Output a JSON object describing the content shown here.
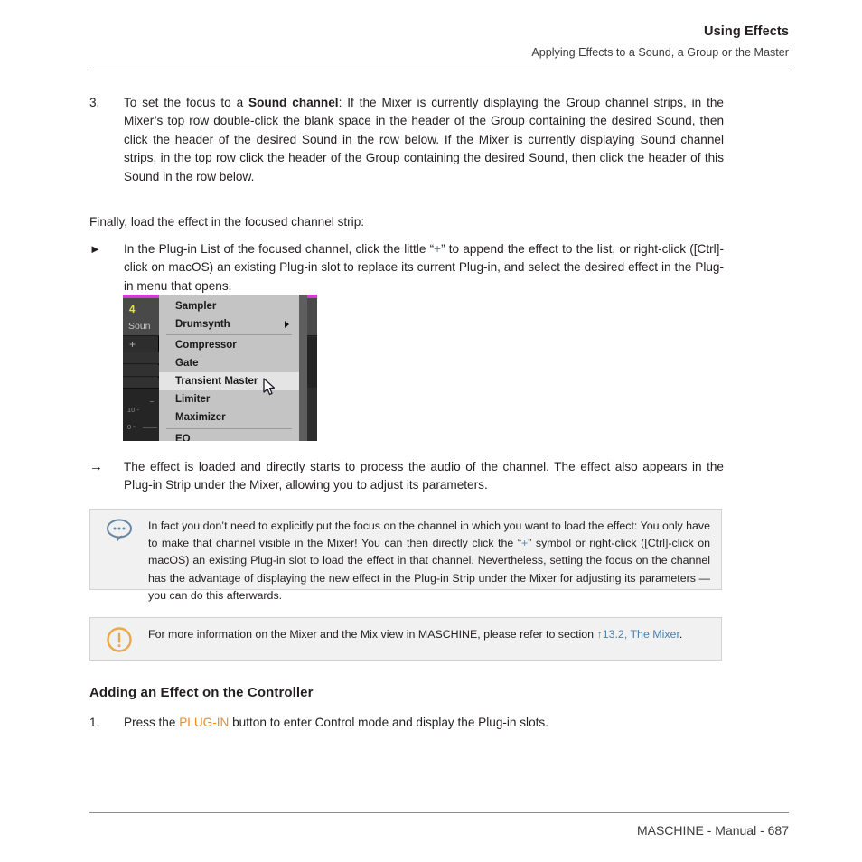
{
  "header": {
    "title": "Using Effects",
    "subtitle": "Applying Effects to a Sound, a Group or the Master"
  },
  "steps": {
    "step3": {
      "marker": "3.",
      "lead": "To set the focus to a ",
      "bold": "Sound channel",
      "rest": ": If the Mixer is currently displaying the Group channel strips, in the Mixer’s top row double-click the blank space in the header of the Group containing the desired Sound, then click the header of the desired Sound in the row below. If the Mixer is currently displaying Sound channel strips, in the top row click the header of the Group containing the desired Sound, then click the header of this Sound in the row below."
    },
    "finally_para": "Finally, load the effect in the focused channel strip:",
    "bullet": {
      "marker": "►",
      "part1": "In the Plug-in List of the focused channel, click the little “",
      "plus": "+",
      "part2": "” to append the effect to the list, or right-click ([Ctrl]-click on macOS) an existing Plug-in slot to replace its current Plug-in, and select the desired effect in the Plug-in menu that opens."
    },
    "result": {
      "marker": "→",
      "text": "The effect is loaded and directly starts to process the audio of the channel. The effect also appears in the Plug-in Strip under the Mixer, allowing you to adjust its parameters."
    }
  },
  "screenshot": {
    "channel_strip": {
      "number": "4",
      "name": "Soun",
      "plus": "+",
      "meter_scale": [
        "10 -",
        "0  -"
      ]
    },
    "menu_items": [
      {
        "label": "Sampler",
        "submenu": false,
        "highlighted": false,
        "separator_after": false
      },
      {
        "label": "Drumsynth",
        "submenu": true,
        "highlighted": false,
        "separator_after": true
      },
      {
        "label": "Compressor",
        "submenu": false,
        "highlighted": false,
        "separator_after": false
      },
      {
        "label": "Gate",
        "submenu": false,
        "highlighted": false,
        "separator_after": false
      },
      {
        "label": "Transient Master",
        "submenu": false,
        "highlighted": true,
        "separator_after": false
      },
      {
        "label": "Limiter",
        "submenu": false,
        "highlighted": false,
        "separator_after": false
      },
      {
        "label": "Maximizer",
        "submenu": false,
        "highlighted": false,
        "separator_after": true
      },
      {
        "label": "EQ",
        "submenu": false,
        "highlighted": false,
        "separator_after": false
      }
    ]
  },
  "tip_box": {
    "icon": "speech-bubble-icon",
    "part1": "In fact you don’t need to explicitly put the focus on the channel in which you want to load the effect: You only have to make that channel visible in the Mixer! You can then directly click the “",
    "plus": "+",
    "part2": "” symbol or right-click ([Ctrl]-click on macOS) an existing Plug-in slot to load the effect in that channel. Nevertheless, setting the focus on the channel has the advantage of displaying the new effect in the Plug-in Strip under the Mixer for adjusting its parameters — you can do this afterwards."
  },
  "info_box": {
    "icon": "exclamation-circle-icon",
    "part1": "For more information on the Mixer and the Mix view in MASCHINE, please refer to section ",
    "link": "↑13.2, The Mixer",
    "part2": "."
  },
  "section": {
    "heading": "Adding an Effect on the Controller",
    "step1": {
      "marker": "1.",
      "part1": "Press the ",
      "button": "PLUG-IN",
      "part2": " button to enter Control mode and display the Plug-in slots."
    }
  },
  "footer": {
    "text": "MASCHINE - Manual - 687"
  },
  "colors": {
    "accent_orange": "#ef8b22",
    "link_blue": "#4b7fae",
    "plus_blue": "#5e82a8",
    "tip_icon": "#6988a3",
    "info_icon": "#e8a94a",
    "strip_magenta": "#d13fd1",
    "strip_yellow": "#e8e82a"
  }
}
